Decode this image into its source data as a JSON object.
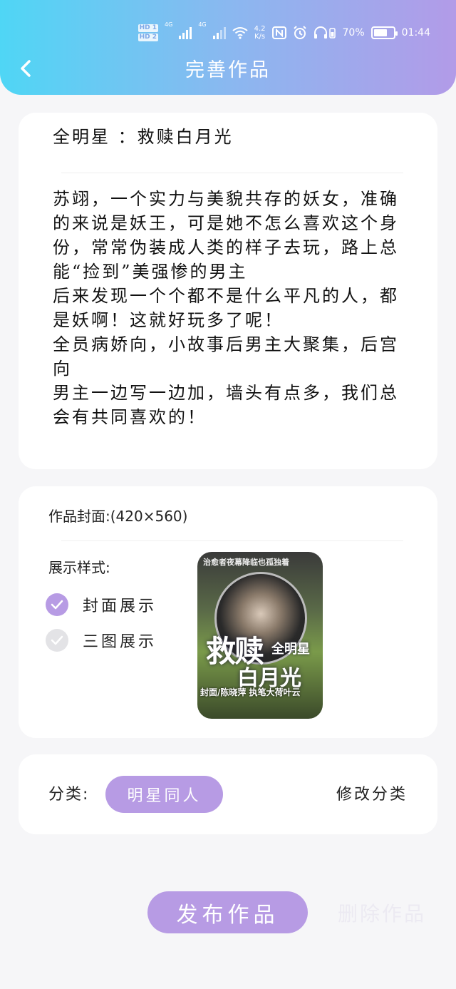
{
  "status_bar": {
    "hd1": "HD 1",
    "hd2": "HD 2",
    "signal1": "4G",
    "signal2": "4G",
    "speed_value": "4.2",
    "speed_unit": "K/s",
    "battery_percent": "70%",
    "battery_level": 0.7,
    "time": "01:44"
  },
  "header": {
    "title": "完善作品",
    "back_icon": "chevron-left-icon"
  },
  "work": {
    "title": "全明星 ：救赎白月光",
    "synopsis": "苏翊，一个实力与美貌共存的妖女，准确的来说是妖王，可是她不怎么喜欢这个身份，常常伪装成人类的样子去玩，路上总能“捡到”美强惨的男主\n后来发现一个个都不是什么平凡的人，都是妖啊！这就好玩多了呢！\n全员病娇向，小故事后男主大聚集，后宫向\n男主一边写一边加，墙头有点多，我们总会有共同喜欢的！"
  },
  "cover": {
    "label": "作品封面:(420×560)",
    "style_label": "展示样式:",
    "options": [
      {
        "label": "封面展示",
        "selected": true
      },
      {
        "label": "三图展示",
        "selected": false
      }
    ],
    "image_text": {
      "top_line": "治愈者夜幕降临也孤独着",
      "big": "救赎",
      "side": "全明星",
      "mid": "白月光",
      "author": "封面/陈晓萍 执笔大荷叶云"
    }
  },
  "category": {
    "label": "分类:",
    "value": "明星同人",
    "edit_label": "修改分类"
  },
  "actions": {
    "publish": "发布作品",
    "delete": "删除作品"
  },
  "colors": {
    "accent": "#b79be4",
    "header_start": "#4fd6f5",
    "header_end": "#b29be8",
    "unselected": "#e3e3e6"
  }
}
